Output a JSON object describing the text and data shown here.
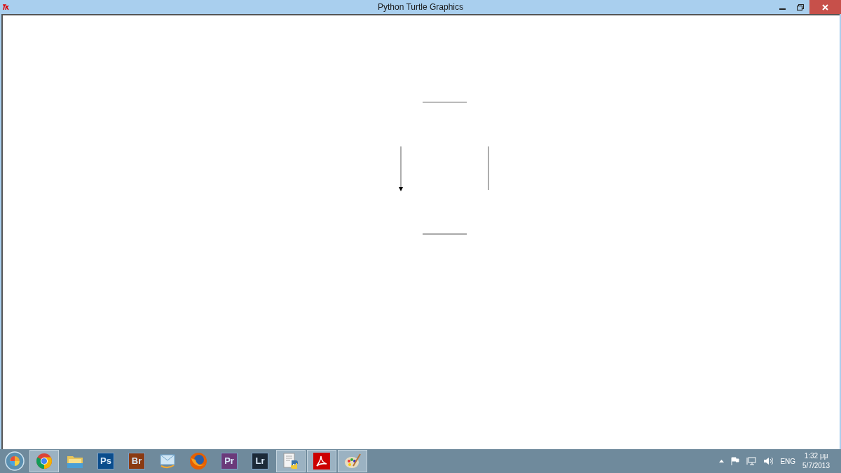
{
  "window": {
    "title": "Python Turtle Graphics"
  },
  "taskbar": {
    "apps": [
      {
        "kind": "start"
      },
      {
        "kind": "chrome",
        "running": true
      },
      {
        "kind": "folder",
        "running": false
      },
      {
        "kind": "badge",
        "label": "Ps",
        "color": "#0a4d8c",
        "running": false
      },
      {
        "kind": "badge",
        "label": "Br",
        "color": "#8a3a12",
        "running": false
      },
      {
        "kind": "mail",
        "running": false
      },
      {
        "kind": "firefox",
        "running": false
      },
      {
        "kind": "badge",
        "label": "Pr",
        "color": "#6b3a7a",
        "running": false
      },
      {
        "kind": "badge",
        "label": "Lr",
        "color": "#1c2a38",
        "running": false
      },
      {
        "kind": "python",
        "running": true
      },
      {
        "kind": "pdf",
        "running": true
      },
      {
        "kind": "paint",
        "running": true
      }
    ],
    "language": "ENG",
    "time": "1:32 μμ",
    "date": "5/7/2013"
  }
}
